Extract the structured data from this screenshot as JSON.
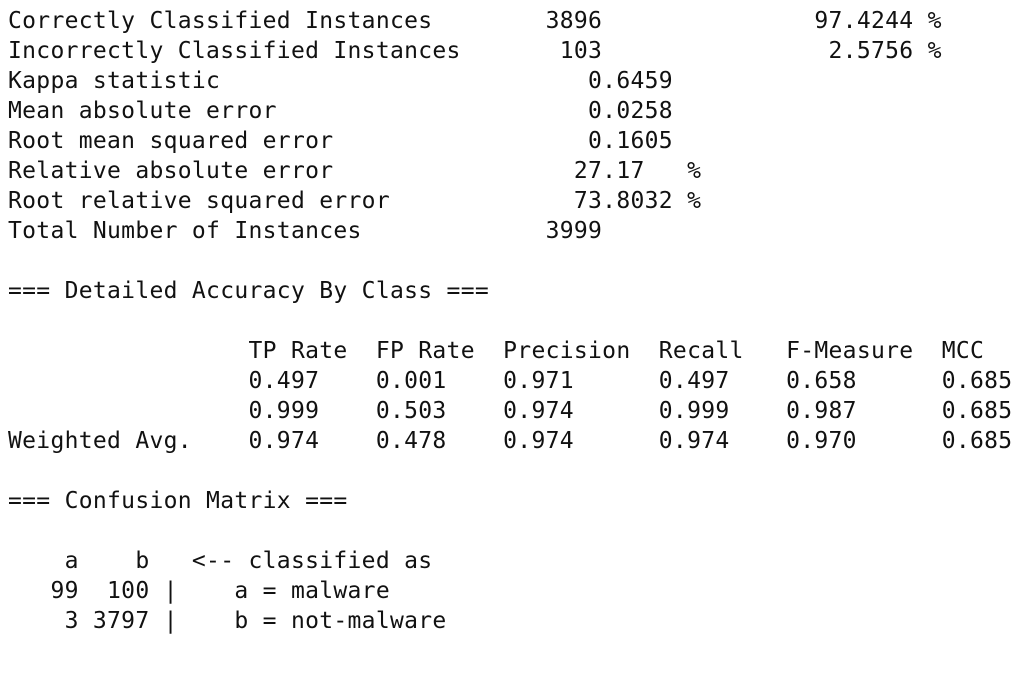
{
  "summary": [
    "Correctly Classified Instances        3896               97.4244 %",
    "Incorrectly Classified Instances       103                2.5756 %",
    "Kappa statistic                          0.6459",
    "Mean absolute error                      0.0258",
    "Root mean squared error                  0.1605",
    "Relative absolute error                 27.17   %",
    "Root relative squared error             73.8032 %",
    "Total Number of Instances             3999"
  ],
  "accuracy_header": "=== Detailed Accuracy By Class ===",
  "accuracy_table": [
    "                 TP Rate  FP Rate  Precision  Recall   F-Measure  MCC",
    "                 0.497    0.001    0.971      0.497    0.658      0.685",
    "                 0.999    0.503    0.974      0.999    0.987      0.685",
    "Weighted Avg.    0.974    0.478    0.974      0.974    0.970      0.685"
  ],
  "confusion_header": "=== Confusion Matrix ===",
  "confusion_matrix": [
    "    a    b   <-- classified as",
    "   99  100 |    a = malware",
    "    3 3797 |    b = not-malware"
  ]
}
